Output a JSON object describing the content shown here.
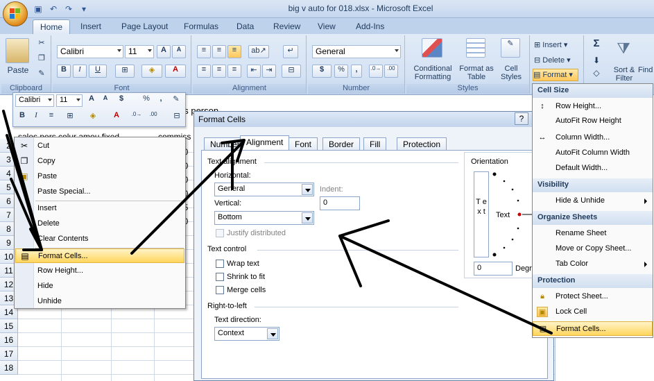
{
  "window": {
    "title": "big v auto for 018.xlsx - Microsoft Excel"
  },
  "tabs": [
    "Home",
    "Insert",
    "Page Layout",
    "Formulas",
    "Data",
    "Review",
    "View",
    "Add-Ins"
  ],
  "ribbon": {
    "paste": "Paste",
    "clipboard": "Clipboard",
    "font_name": "Calibri",
    "font_size": "11",
    "font": "Font",
    "alignment": "Alignment",
    "number_format": "General",
    "number": "Number",
    "currency": "$",
    "percent": "%",
    "comma": ",",
    "conditional_formatting": "Conditional Formatting",
    "format_as_table": "Format as Table",
    "cell_styles": "Cell Styles",
    "styles": "Styles",
    "insert": "Insert",
    "delete": "Delete",
    "format": "Format",
    "sort_filter": "Sort & Filter",
    "find_select": "Find & Sele"
  },
  "mini_toolbar": {
    "font": "Calibri",
    "size": "11",
    "currency": "$",
    "percent": "%",
    "comma": ","
  },
  "sheet": {
    "row_numbers": [
      "2",
      "3",
      "4",
      "5",
      "6",
      "7",
      "8",
      "9",
      "10",
      "11",
      "12",
      "13",
      "14",
      "15",
      "16",
      "17",
      "18"
    ],
    "header_fragment": "sales pers colur amou fixed",
    "commission_header": "commiss",
    "cell_fragment": "es person",
    "partial_values": [
      "40",
      "90",
      "00",
      "60",
      "25",
      "60"
    ]
  },
  "context_menu": {
    "items": [
      "Cut",
      "Copy",
      "Paste",
      "Paste Special...",
      "Insert",
      "Delete",
      "Clear Contents",
      "Format Cells...",
      "Row Height...",
      "Hide",
      "Unhide"
    ]
  },
  "dialog": {
    "title": "Format Cells",
    "help": "?",
    "tabs": [
      "Number",
      "Alignment",
      "Font",
      "Border",
      "Fill",
      "Protection"
    ],
    "text_alignment": "Text alignment",
    "horizontal_label": "Horizontal:",
    "horizontal_value": "General",
    "indent_label": "Indent:",
    "indent_value": "0",
    "vertical_label": "Vertical:",
    "vertical_value": "Bottom",
    "justify_distributed": "Justify distributed",
    "text_control": "Text control",
    "wrap_text": "Wrap text",
    "shrink_to_fit": "Shrink to fit",
    "merge_cells": "Merge cells",
    "right_to_left": "Right-to-left",
    "text_direction_label": "Text direction:",
    "text_direction_value": "Context",
    "orientation": "Orientation",
    "orientation_vertical_text": "T e x t",
    "orientation_text": "Text",
    "degrees_value": "0",
    "degrees_label": "Degr"
  },
  "format_menu": {
    "cell_size": "Cell Size",
    "row_height": "Row Height...",
    "autofit_row_height": "AutoFit Row Height",
    "column_width": "Column Width...",
    "autofit_column_width": "AutoFit Column Width",
    "default_width": "Default Width...",
    "visibility": "Visibility",
    "hide_unhide": "Hide & Unhide",
    "organize_sheets": "Organize Sheets",
    "rename_sheet": "Rename Sheet",
    "move_copy_sheet": "Move or Copy Sheet...",
    "tab_color": "Tab Color",
    "protection": "Protection",
    "protect_sheet": "Protect Sheet...",
    "lock_cell": "Lock Cell",
    "format_cells": "Format Cells..."
  },
  "colors": {
    "accent": "#1e395b",
    "highlight": "#ffd55c",
    "ribbon": "#d4e2f4"
  }
}
